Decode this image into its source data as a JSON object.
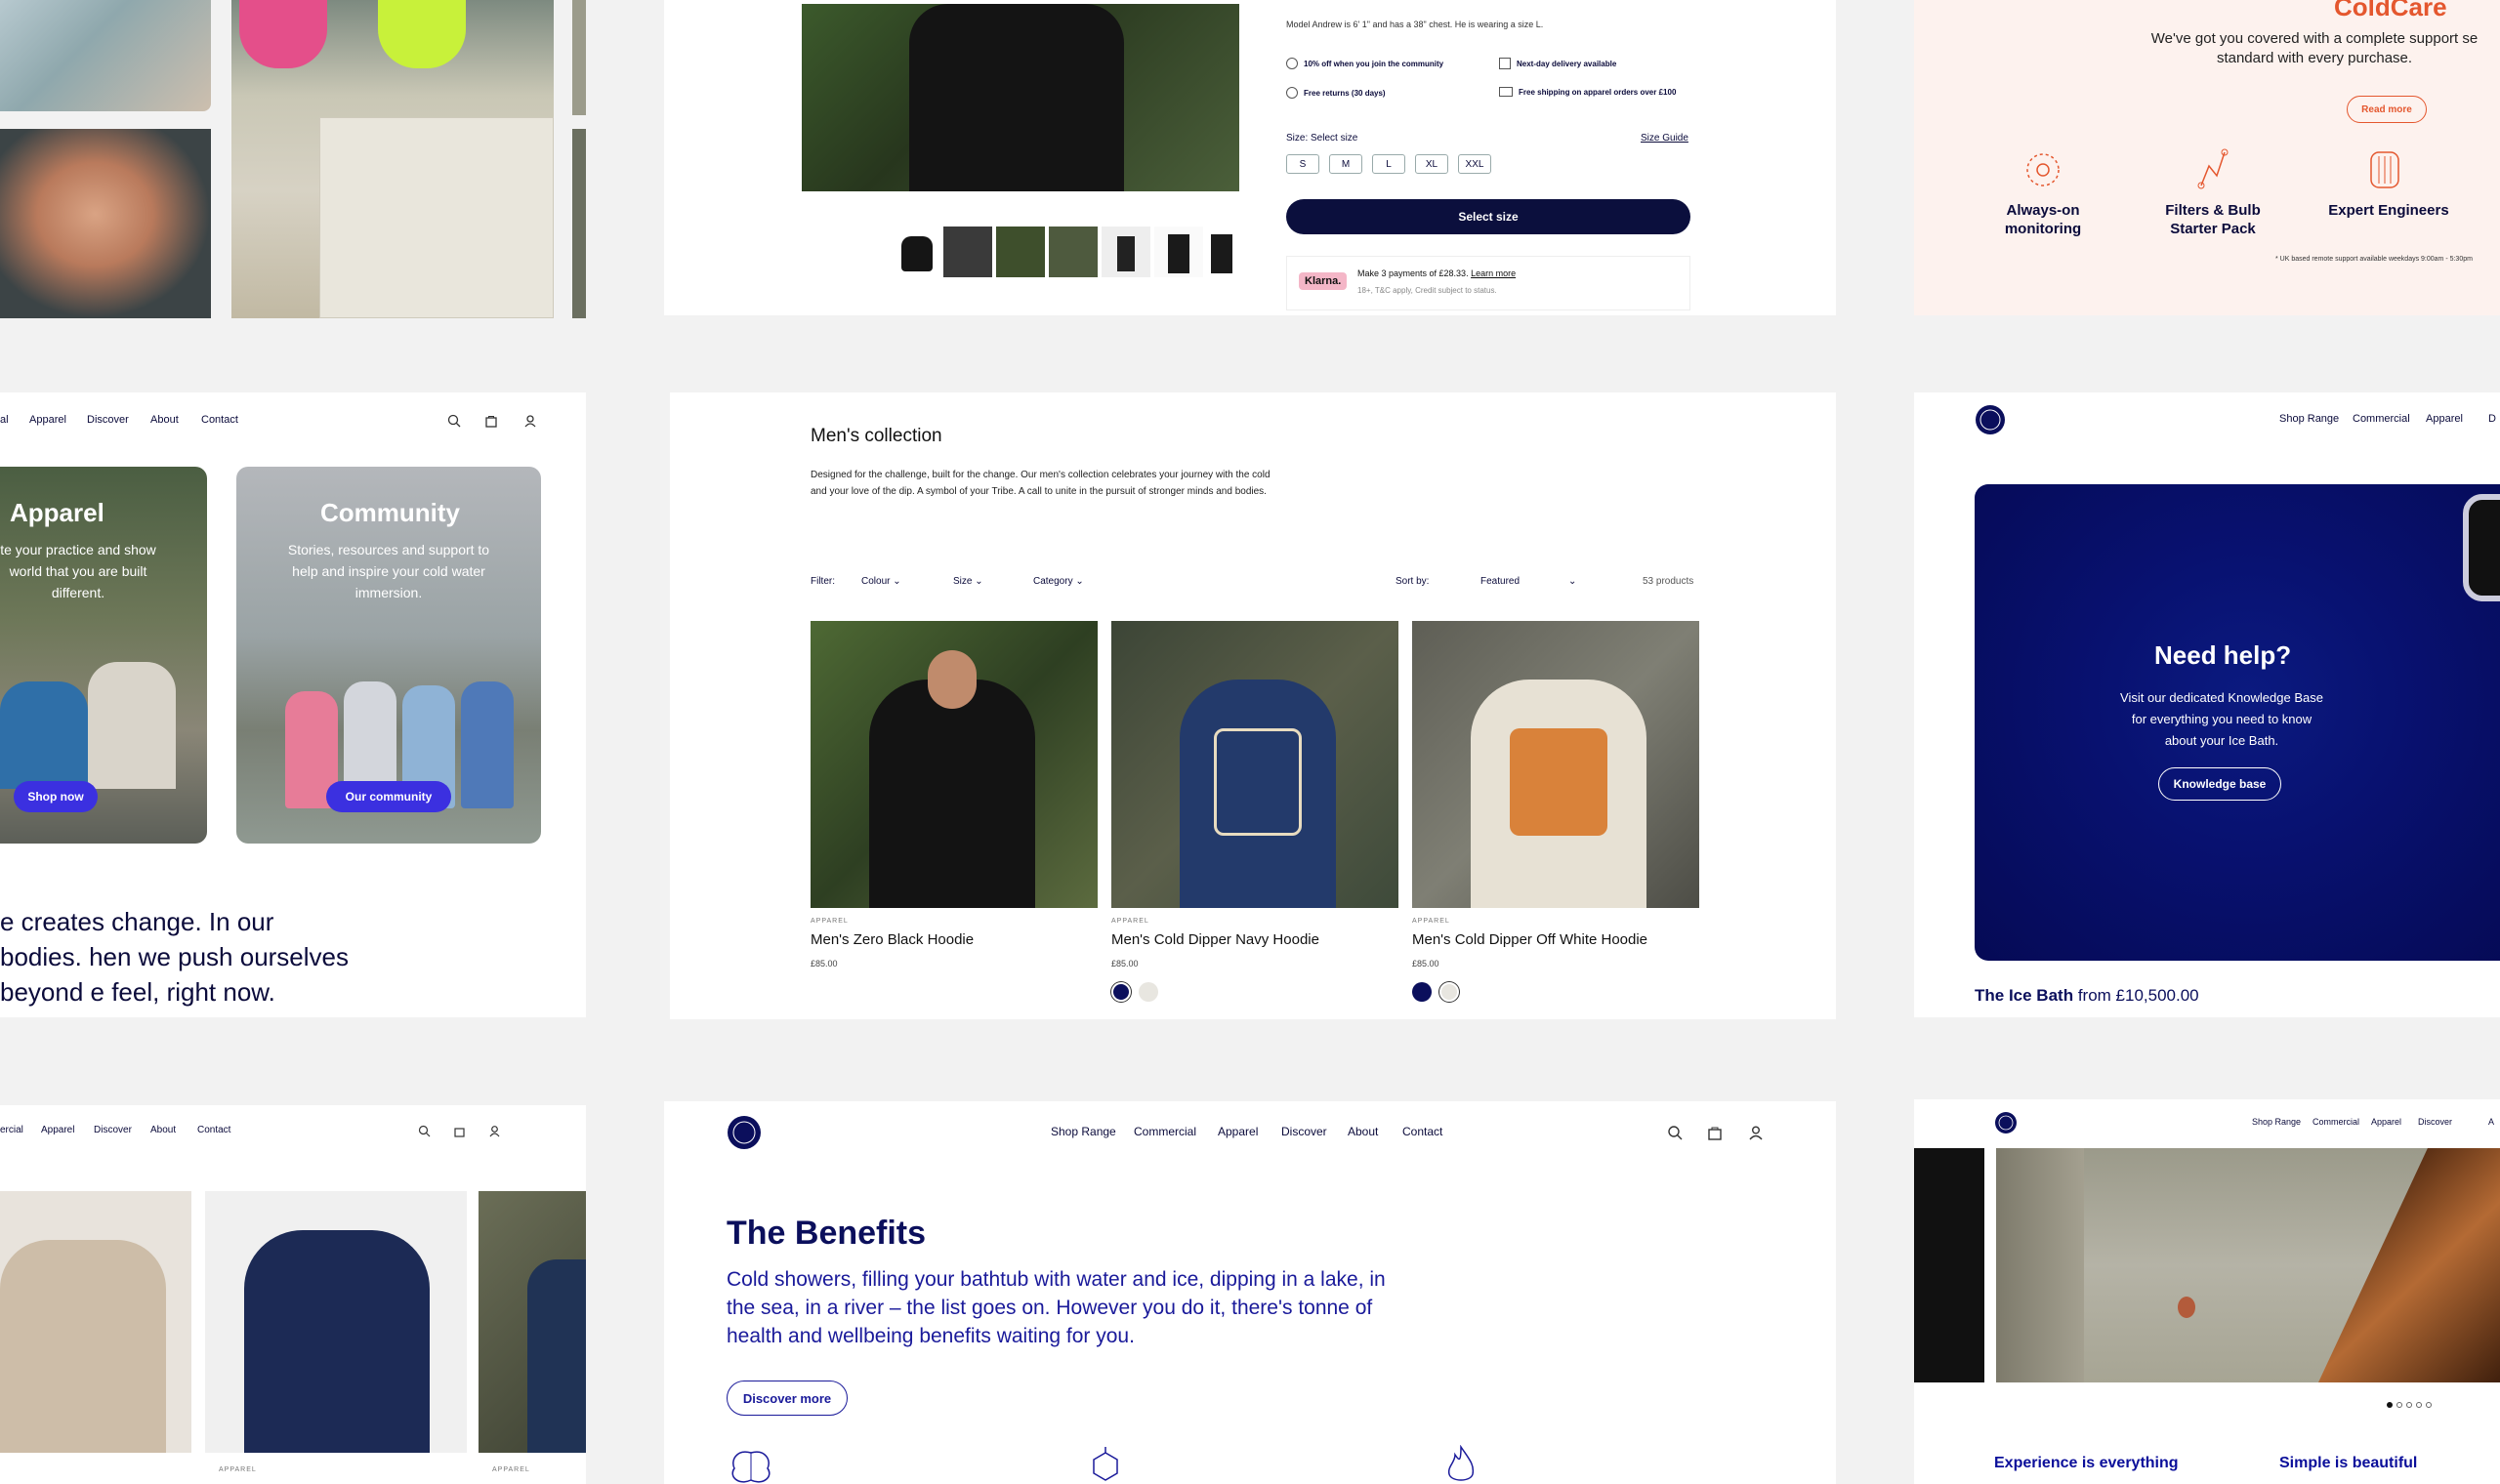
{
  "p1": {},
  "p2": {
    "model_text": "Model Andrew is 6' 1\" and has a 38\" chest. He is wearing a size L.",
    "perks": [
      "10% off when you join the community",
      "Next-day delivery available",
      "Free returns (30 days)",
      "Free shipping on apparel orders over £100"
    ],
    "size_label": "Size: Select size",
    "size_guide": "Size Guide",
    "sizes": [
      "S",
      "M",
      "L",
      "XL",
      "XXL"
    ],
    "select_button": "Select size",
    "klarna_badge": "Klarna.",
    "klarna_line1": "Make 3 payments of £28.33.",
    "klarna_learn": "Learn more",
    "klarna_line2": "18+, T&C apply, Credit subject to status."
  },
  "p3": {
    "title": "ColdCare",
    "subtitle": "We've got you covered with a complete support se standard with every purchase.",
    "read_more": "Read more",
    "features": [
      "Always-on monitoring",
      "Filters & Bulb Starter Pack",
      "Expert Engineers"
    ],
    "footnote": "* UK based remote support available weekdays 9:00am - 5:30pm"
  },
  "p4": {
    "nav": [
      "al",
      "Apparel",
      "Discover",
      "About",
      "Contact"
    ],
    "card1_title": "Apparel",
    "card1_text": "te your practice and show world that you are built different.",
    "card1_button": "Shop now",
    "card2_title": "Community",
    "card2_text": "Stories, resources and support to help and inspire your cold water immersion.",
    "card2_button": "Our community",
    "quote": "e creates change. In our bodies. hen we push ourselves beyond e feel, right now."
  },
  "p5": {
    "title": "Men's collection",
    "description": "Designed for the challenge, built for the change. Our men's collection celebrates your journey with the cold and your love of the dip. A symbol of your Tribe. A call to unite in the pursuit of stronger minds and bodies.",
    "filter_label": "Filter:",
    "filters": [
      "Colour",
      "Size",
      "Category"
    ],
    "sort_label": "Sort by:",
    "sort_value": "Featured",
    "count": "53 products",
    "products": [
      {
        "cat": "APPAREL",
        "name": "Men's Zero Black Hoodie",
        "price": "£85.00"
      },
      {
        "cat": "APPAREL",
        "name": "Men's Cold Dipper Navy Hoodie",
        "price": "£85.00"
      },
      {
        "cat": "APPAREL",
        "name": "Men's Cold Dipper Off White Hoodie",
        "price": "£85.00"
      }
    ]
  },
  "p6": {
    "nav": [
      "Shop Range",
      "Commercial",
      "Apparel",
      "D"
    ],
    "heading": "Need help?",
    "text": "Visit our dedicated Knowledge Base for everything you need to know about your Ice Bath.",
    "button": "Knowledge base",
    "price_name": "The Ice Bath",
    "price_rest": "from £10,500.00"
  },
  "p7": {
    "nav": [
      "ercial",
      "Apparel",
      "Discover",
      "About",
      "Contact"
    ],
    "cat1": "APPAREL",
    "cat2": "APPAREL"
  },
  "p8": {
    "nav": [
      "Shop Range",
      "Commercial",
      "Apparel",
      "Discover",
      "About",
      "Contact"
    ],
    "title": "The Benefits",
    "body": "Cold showers, filling your bathtub with water and ice, dipping in a lake, in the sea, in a river – the list goes on. However you do it, there's tonne of health and wellbeing benefits waiting for you.",
    "button": "Discover more"
  },
  "p9": {
    "nav": [
      "Shop Range",
      "Commercial",
      "Apparel",
      "Discover",
      "A"
    ],
    "h1": "Experience is everything",
    "h2": "Simple is beautiful"
  },
  "colors": {
    "navy": "#0b0f5c",
    "brand_blue": "#3b30e0",
    "coral": "#e4572e",
    "peach": "#fdf2ee"
  }
}
